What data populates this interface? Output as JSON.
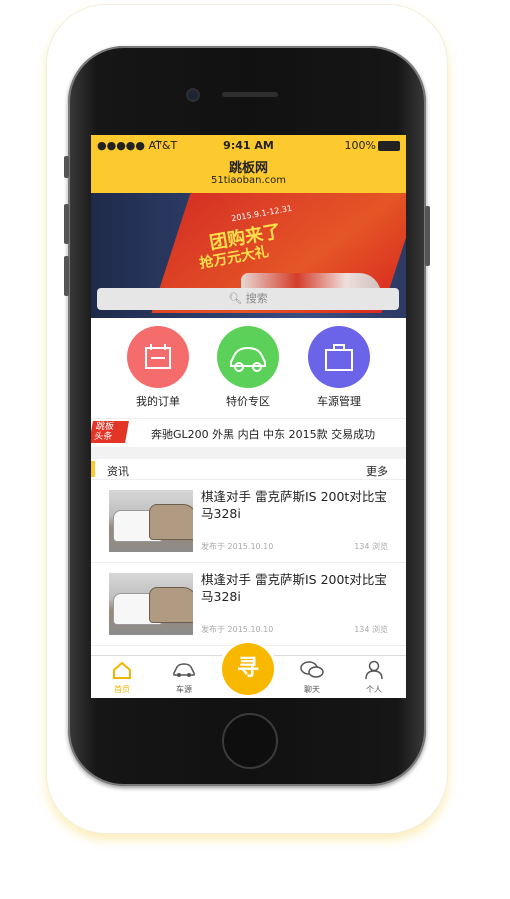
{
  "status_bar": {
    "carrier": "AT&T",
    "time": "9:41 AM",
    "battery": "100%"
  },
  "header": {
    "title": "跳板网",
    "subtitle": "51tiaoban.com"
  },
  "banner": {
    "slogan": "团购来了",
    "slogan2": "抢万元大礼",
    "date_text": "2015.9.1-12.31"
  },
  "search": {
    "placeholder": "搜索"
  },
  "quick_actions": [
    {
      "label": "我的订单",
      "color": "#f56c6c",
      "icon": "order-icon"
    },
    {
      "label": "特价专区",
      "color": "#5bd15a",
      "icon": "car-icon"
    },
    {
      "label": "车源管理",
      "color": "#6b63e8",
      "icon": "briefcase-icon"
    }
  ],
  "news_ticker": {
    "tag_line1": "跳板",
    "tag_line2": "头条",
    "text": "奔驰GL200 外黑 内白 中东 2015款 交易成功"
  },
  "section": {
    "title": "资讯",
    "more": "更多"
  },
  "articles": [
    {
      "title": "棋逢对手 雷克萨斯IS 200t对比宝马328i",
      "date": "发布于 2015.10.10",
      "views": "134 浏览"
    },
    {
      "title": "棋逢对手 雷克萨斯IS 200t对比宝马328i",
      "date": "发布于 2015.10.10",
      "views": "134 浏览"
    }
  ],
  "tabbar": {
    "home": "首页",
    "cars": "车源",
    "find": "寻",
    "chat": "聊天",
    "me": "个人",
    "accent": "#f9b800"
  },
  "colors": {
    "brand_yellow": "#fcc92f",
    "news_red": "#e23528"
  }
}
